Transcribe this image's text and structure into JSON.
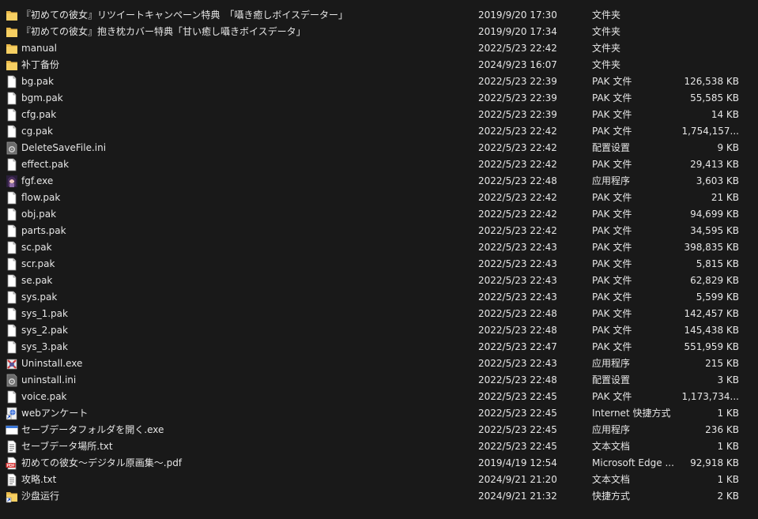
{
  "files": [
    {
      "name": "『初めての彼女』リツイートキャンペーン特典　「囁き癒しボイスデーター」",
      "date": "2019/9/20 17:30",
      "type": "文件夹",
      "size": "",
      "icon": "folder-icon"
    },
    {
      "name": "『初めての彼女』抱き枕カバー特典「甘い癒し囁きボイスデータ」",
      "date": "2019/9/20 17:34",
      "type": "文件夹",
      "size": "",
      "icon": "folder-icon"
    },
    {
      "name": "manual",
      "date": "2022/5/23 22:42",
      "type": "文件夹",
      "size": "",
      "icon": "folder-icon"
    },
    {
      "name": "补丁备份",
      "date": "2024/9/23 16:07",
      "type": "文件夹",
      "size": "",
      "icon": "folder-icon"
    },
    {
      "name": "bg.pak",
      "date": "2022/5/23 22:39",
      "type": "PAK 文件",
      "size": "126,538 KB",
      "icon": "file-icon"
    },
    {
      "name": "bgm.pak",
      "date": "2022/5/23 22:39",
      "type": "PAK 文件",
      "size": "55,585 KB",
      "icon": "file-icon"
    },
    {
      "name": "cfg.pak",
      "date": "2022/5/23 22:39",
      "type": "PAK 文件",
      "size": "14 KB",
      "icon": "file-icon"
    },
    {
      "name": "cg.pak",
      "date": "2022/5/23 22:42",
      "type": "PAK 文件",
      "size": "1,754,157...",
      "icon": "file-icon"
    },
    {
      "name": "DeleteSaveFile.ini",
      "date": "2022/5/23 22:42",
      "type": "配置设置",
      "size": "9 KB",
      "icon": "settings-file-icon"
    },
    {
      "name": "effect.pak",
      "date": "2022/5/23 22:42",
      "type": "PAK 文件",
      "size": "29,413 KB",
      "icon": "file-icon"
    },
    {
      "name": "fgf.exe",
      "date": "2022/5/23 22:48",
      "type": "应用程序",
      "size": "3,603 KB",
      "icon": "app-icon"
    },
    {
      "name": "flow.pak",
      "date": "2022/5/23 22:42",
      "type": "PAK 文件",
      "size": "21 KB",
      "icon": "file-icon"
    },
    {
      "name": "obj.pak",
      "date": "2022/5/23 22:42",
      "type": "PAK 文件",
      "size": "94,699 KB",
      "icon": "file-icon"
    },
    {
      "name": "parts.pak",
      "date": "2022/5/23 22:42",
      "type": "PAK 文件",
      "size": "34,595 KB",
      "icon": "file-icon"
    },
    {
      "name": "sc.pak",
      "date": "2022/5/23 22:43",
      "type": "PAK 文件",
      "size": "398,835 KB",
      "icon": "file-icon"
    },
    {
      "name": "scr.pak",
      "date": "2022/5/23 22:43",
      "type": "PAK 文件",
      "size": "5,815 KB",
      "icon": "file-icon"
    },
    {
      "name": "se.pak",
      "date": "2022/5/23 22:43",
      "type": "PAK 文件",
      "size": "62,829 KB",
      "icon": "file-icon"
    },
    {
      "name": "sys.pak",
      "date": "2022/5/23 22:43",
      "type": "PAK 文件",
      "size": "5,599 KB",
      "icon": "file-icon"
    },
    {
      "name": "sys_1.pak",
      "date": "2022/5/23 22:48",
      "type": "PAK 文件",
      "size": "142,457 KB",
      "icon": "file-icon"
    },
    {
      "name": "sys_2.pak",
      "date": "2022/5/23 22:48",
      "type": "PAK 文件",
      "size": "145,438 KB",
      "icon": "file-icon"
    },
    {
      "name": "sys_3.pak",
      "date": "2022/5/23 22:47",
      "type": "PAK 文件",
      "size": "551,959 KB",
      "icon": "file-icon"
    },
    {
      "name": "Uninstall.exe",
      "date": "2022/5/23 22:43",
      "type": "应用程序",
      "size": "215 KB",
      "icon": "uninstall-app-icon"
    },
    {
      "name": "uninstall.ini",
      "date": "2022/5/23 22:48",
      "type": "配置设置",
      "size": "3 KB",
      "icon": "settings-file-icon"
    },
    {
      "name": "voice.pak",
      "date": "2022/5/23 22:45",
      "type": "PAK 文件",
      "size": "1,173,734...",
      "icon": "file-icon"
    },
    {
      "name": "webアンケート",
      "date": "2022/5/23 22:45",
      "type": "Internet 快捷方式",
      "size": "1 KB",
      "icon": "internet-shortcut-icon"
    },
    {
      "name": "セーブデータフォルダを開く.exe",
      "date": "2022/5/23 22:45",
      "type": "应用程序",
      "size": "236 KB",
      "icon": "window-app-icon"
    },
    {
      "name": "セーブデータ場所.txt",
      "date": "2022/5/23 22:45",
      "type": "文本文档",
      "size": "1 KB",
      "icon": "text-file-icon"
    },
    {
      "name": "初めての彼女～デジタル原画集～.pdf",
      "date": "2019/4/19 12:54",
      "type": "Microsoft Edge ...",
      "size": "92,918 KB",
      "icon": "pdf-icon"
    },
    {
      "name": "攻略.txt",
      "date": "2024/9/21 21:20",
      "type": "文本文档",
      "size": "1 KB",
      "icon": "text-file-icon"
    },
    {
      "name": "沙盘运行",
      "date": "2024/9/21 21:32",
      "type": "快捷方式",
      "size": "2 KB",
      "icon": "shortcut-icon"
    }
  ]
}
